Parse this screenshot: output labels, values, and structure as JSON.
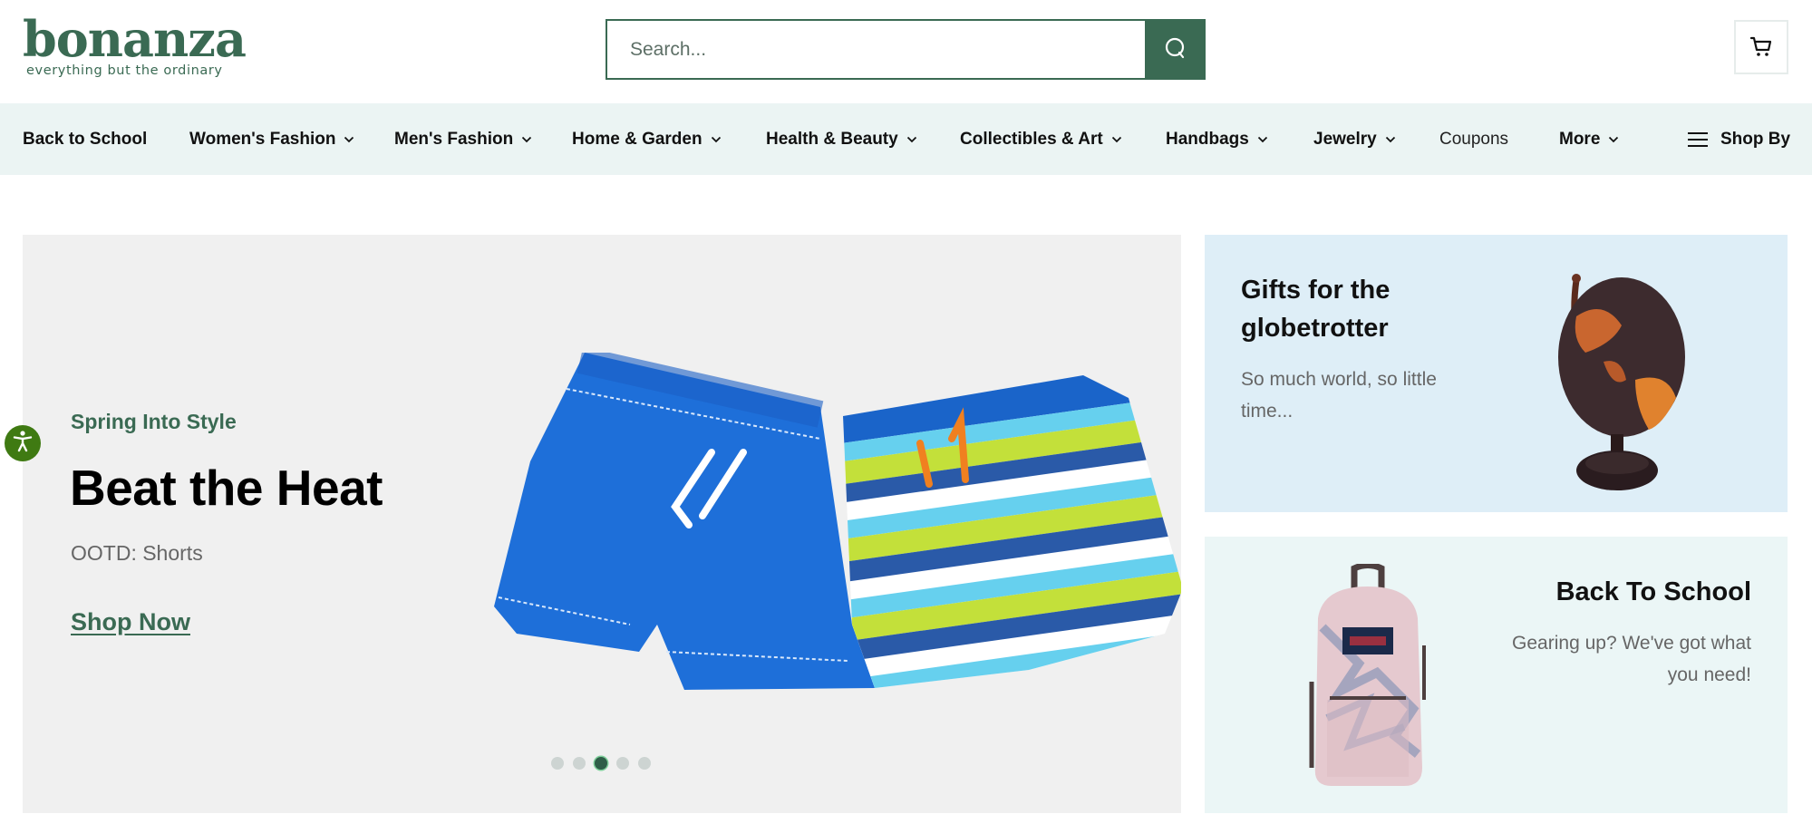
{
  "header": {
    "logo": {
      "wordmark": "bonanza",
      "tagline": "everything but the ordinary"
    },
    "search": {
      "placeholder": "Search...",
      "value": "",
      "button_icon": "search-icon"
    },
    "cart": {
      "icon": "cart-icon"
    }
  },
  "nav": {
    "items": [
      {
        "label": "Back to School",
        "has_dropdown": false
      },
      {
        "label": "Women's Fashion",
        "has_dropdown": true
      },
      {
        "label": "Men's Fashion",
        "has_dropdown": true
      },
      {
        "label": "Home & Garden",
        "has_dropdown": true
      },
      {
        "label": "Health & Beauty",
        "has_dropdown": true
      },
      {
        "label": "Collectibles & Art",
        "has_dropdown": true
      },
      {
        "label": "Handbags",
        "has_dropdown": true
      },
      {
        "label": "Jewelry",
        "has_dropdown": true
      },
      {
        "label": "Coupons",
        "has_dropdown": false
      },
      {
        "label": "More",
        "has_dropdown": true
      }
    ],
    "shop_by": {
      "label": "Shop By",
      "icon": "menu-icon"
    }
  },
  "hero": {
    "eyebrow": "Spring Into Style",
    "title": "Beat the Heat",
    "subtitle": "OOTD: Shorts",
    "cta": "Shop Now",
    "image": "two pairs of kids' shorts (solid blue and striped)",
    "carousel": {
      "total_slides": 5,
      "active_slide": 3
    }
  },
  "promos": [
    {
      "title": "Gifts for the globetrotter",
      "text": "So much world, so little time...",
      "image": "antique world globe on stand"
    },
    {
      "title": "Back To School",
      "text": "Gearing up? We've got what you need!",
      "image": "JanSport backpack with mountain print"
    }
  ],
  "accessibility": {
    "icon": "accessibility-icon"
  },
  "colors": {
    "brand_green": "#3a6a53",
    "nav_bg": "#ebf4f3",
    "hero_bg": "#f0f0f0",
    "globe_card_bg": "#deeef7",
    "school_card_bg": "#ebf6f6",
    "a11y_green": "#3f7a12"
  }
}
